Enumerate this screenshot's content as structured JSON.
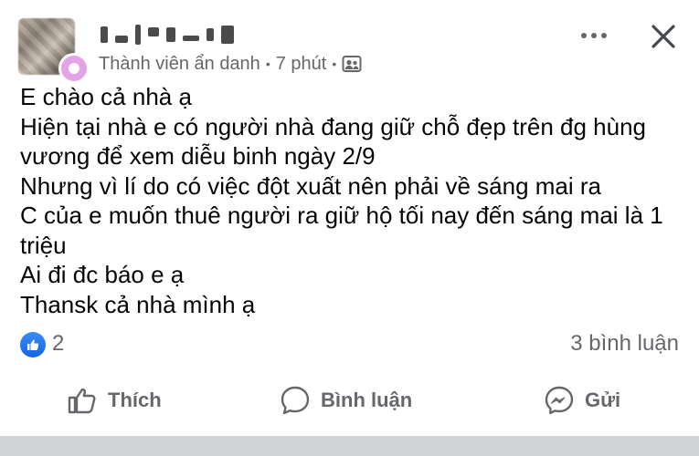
{
  "post": {
    "author_name": "",
    "author_label": "Thành viên ẩn danh",
    "time": "7 phút",
    "audience_icon": "group-icon",
    "body_lines": [
      "E chào cả nhà ạ",
      "Hiện tại nhà e có người nhà đang giữ chỗ đẹp trên đg hùng vương để xem diễu binh ngày 2/9",
      "Nhưng vì lí do có việc đột xuất nên phải về sáng mai ra",
      "C của e muốn thuê người ra giữ hộ tối nay đến sáng mai là 1 triệu",
      "Ai đi đc báo e ạ",
      "Thansk cả nhà mình ạ"
    ],
    "like_count": "2",
    "comment_count": "3 bình luận"
  },
  "actions": {
    "like_label": "Thích",
    "comment_label": "Bình luận",
    "send_label": "Gửi"
  },
  "colors": {
    "meta_text": "#65676b",
    "like_blue": "#1877f2",
    "anon_badge": "#e4a3e6"
  }
}
